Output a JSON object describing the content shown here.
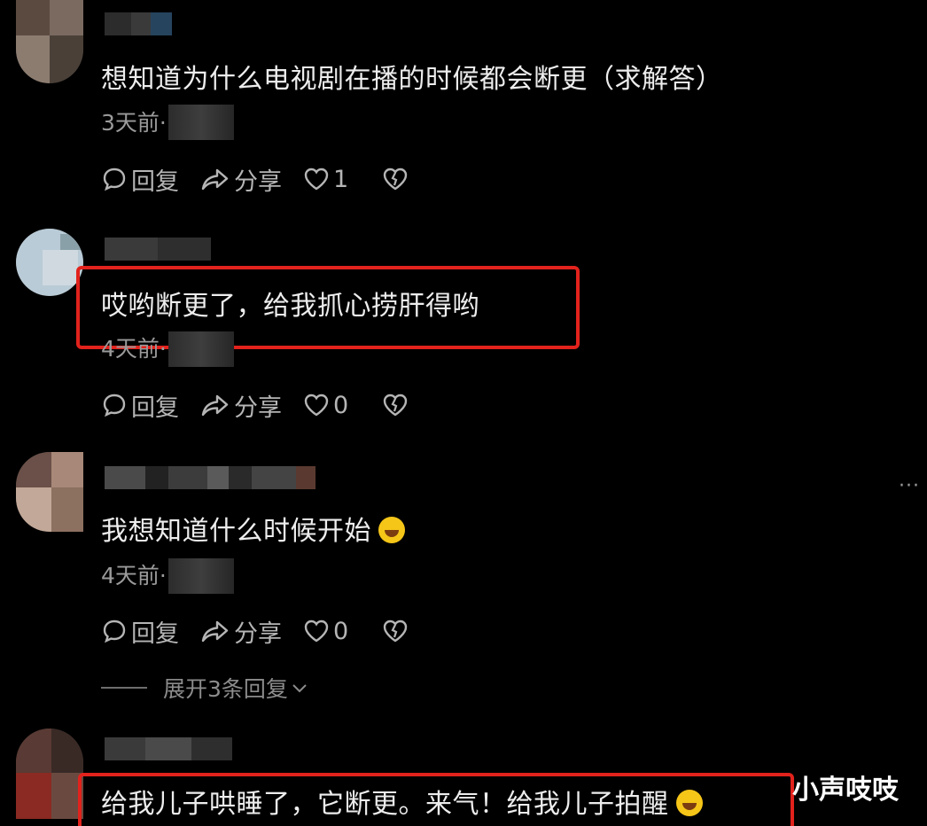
{
  "comments": [
    {
      "text": "想知道为什么电视剧在播的时候都会断更（求解答）",
      "time": "3天前·",
      "actions": {
        "reply": "回复",
        "share": "分享",
        "likes": "1"
      }
    },
    {
      "text": "哎哟断更了，给我抓心捞肝得哟",
      "time": "4天前·",
      "actions": {
        "reply": "回复",
        "share": "分享",
        "likes": "0"
      }
    },
    {
      "text": "我想知道什么时候开始",
      "time": "4天前·",
      "actions": {
        "reply": "回复",
        "share": "分享",
        "likes": "0"
      },
      "expand": "展开3条回复"
    },
    {
      "text": "给我儿子哄睡了，它断更。来气！给我儿子拍醒"
    }
  ],
  "more_label": "···",
  "watermark": "小声吱吱",
  "colors": {
    "highlight": "#e2221c",
    "background": "#000000",
    "emoji": "#f5c518"
  },
  "icons": [
    "comment-icon",
    "share-icon",
    "heart-icon",
    "broken-heart-icon",
    "chevron-down-icon",
    "laughing-emoji-icon"
  ]
}
